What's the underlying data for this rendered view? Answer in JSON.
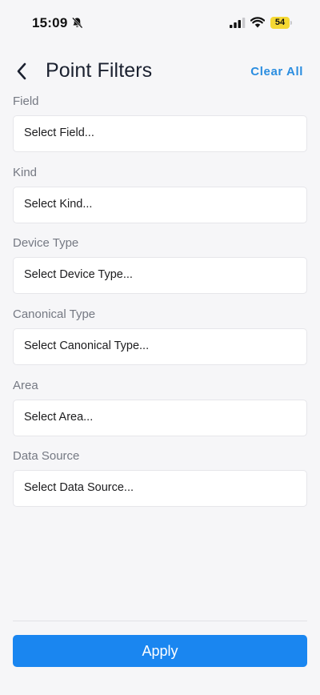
{
  "status_bar": {
    "time": "15:09",
    "battery_level": "54",
    "icons": [
      "bell-slash-icon",
      "cellular-signal-icon",
      "wifi-icon",
      "battery-icon"
    ],
    "battery_color": "#f5d833"
  },
  "header": {
    "title": "Point Filters",
    "clear_all_label": "Clear All",
    "back_icon": "chevron-left-icon"
  },
  "filters": [
    {
      "label": "Field",
      "placeholder": "Select Field..."
    },
    {
      "label": "Kind",
      "placeholder": "Select Kind..."
    },
    {
      "label": "Device Type",
      "placeholder": "Select Device Type..."
    },
    {
      "label": "Canonical Type",
      "placeholder": "Select Canonical Type..."
    },
    {
      "label": "Area",
      "placeholder": "Select Area..."
    },
    {
      "label": "Data Source",
      "placeholder": "Select Data Source..."
    }
  ],
  "footer": {
    "apply_label": "Apply"
  },
  "colors": {
    "accent": "#1a86f0",
    "link": "#2a8de0",
    "background": "#f6f6f8"
  }
}
